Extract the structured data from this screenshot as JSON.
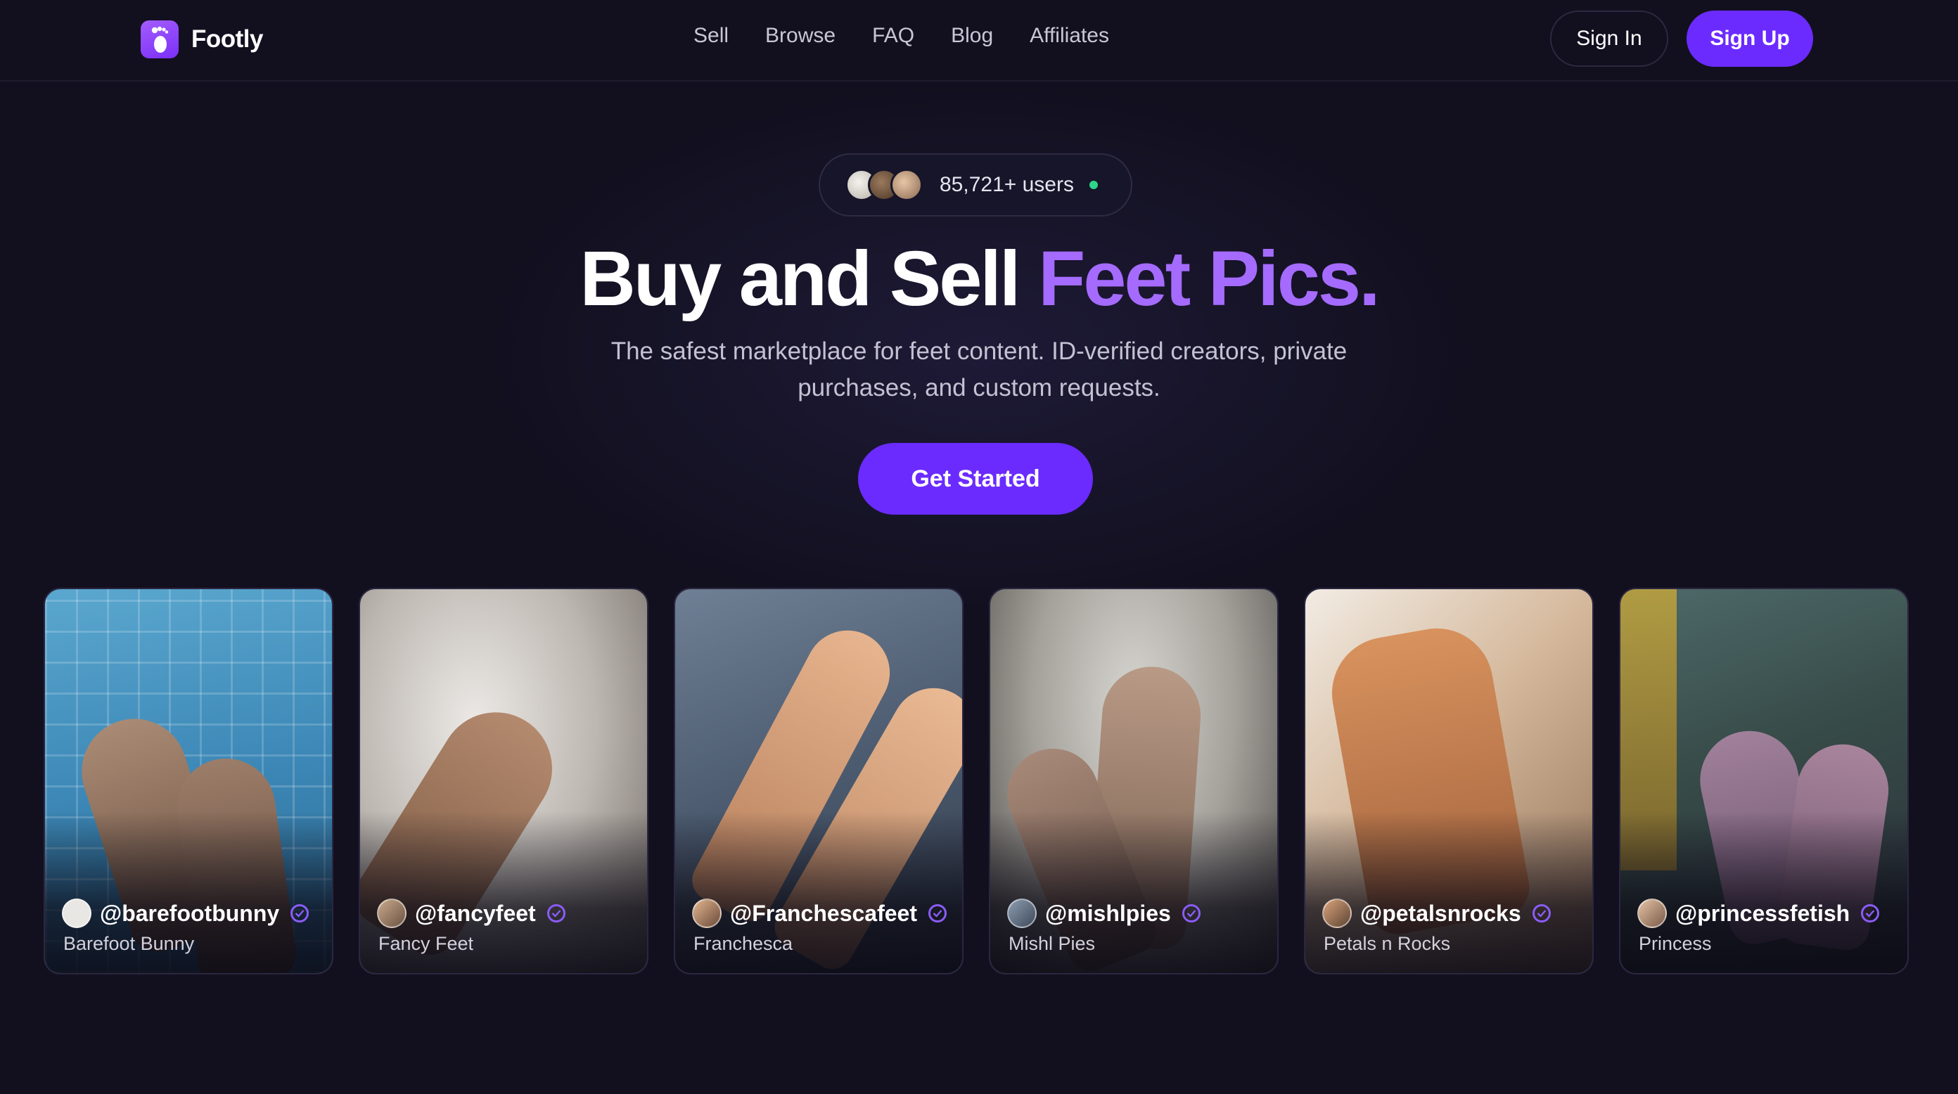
{
  "brand": {
    "name": "Footly"
  },
  "nav": {
    "links": [
      "Sell",
      "Browse",
      "FAQ",
      "Blog",
      "Affiliates"
    ],
    "sign_in": "Sign In",
    "sign_up": "Sign Up"
  },
  "hero": {
    "users_count": "85,721+ users",
    "title_main": "Buy and Sell ",
    "title_accent": "Feet Pics.",
    "subtitle": "The safest marketplace for feet content. ID-verified creators, private purchases, and custom requests.",
    "cta": "Get Started"
  },
  "creators": [
    {
      "handle": "@barefootbunny",
      "name": "Barefoot Bunny",
      "verified": true
    },
    {
      "handle": "@fancyfeet",
      "name": "Fancy Feet",
      "verified": true
    },
    {
      "handle": "@Franchescafeet",
      "name": "Franchesca",
      "verified": true
    },
    {
      "handle": "@mishlpies",
      "name": "Mishl Pies",
      "verified": true
    },
    {
      "handle": "@petalsnrocks",
      "name": "Petals n Rocks",
      "verified": true
    },
    {
      "handle": "@princessfetish",
      "name": "Princess",
      "verified": true
    }
  ],
  "colors": {
    "background": "#12101f",
    "accent": "#6b2bff",
    "accent_text": "#a56bff",
    "online": "#2ed58a",
    "verified": "#8b5cf6"
  }
}
